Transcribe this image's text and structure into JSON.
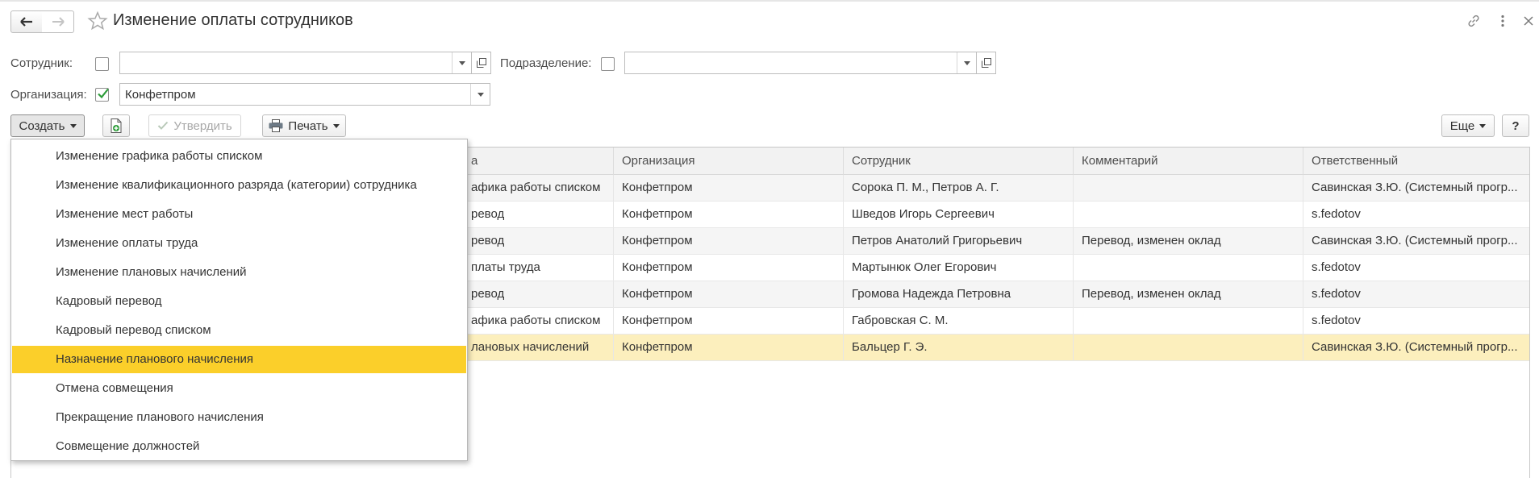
{
  "header": {
    "title": "Изменение оплаты сотрудников"
  },
  "filters": {
    "employee_label": "Сотрудник:",
    "employee_value": "",
    "department_label": "Подразделение:",
    "department_value": "",
    "organization_label": "Организация:",
    "organization_value": "Конфетпром",
    "organization_checked": true
  },
  "toolbar": {
    "create_label": "Создать",
    "approve_label": "Утвердить",
    "print_label": "Печать",
    "more_label": "Еще",
    "help_label": "?"
  },
  "table": {
    "columns": [
      "а",
      "Организация",
      "Сотрудник",
      "Комментарий",
      "Ответственный"
    ],
    "rows": [
      [
        "афика работы списком",
        "Конфетпром",
        "Сорока П. М., Петров А. Г.",
        "",
        "Савинская З.Ю. (Системный прогр..."
      ],
      [
        "ревод",
        "Конфетпром",
        "Шведов Игорь Сергеевич",
        "",
        "s.fedotov"
      ],
      [
        "ревод",
        "Конфетпром",
        "Петров Анатолий Григорьевич",
        "Перевод, изменен оклад",
        "Савинская З.Ю. (Системный прогр..."
      ],
      [
        "платы труда",
        "Конфетпром",
        "Мартынюк Олег Егорович",
        "",
        "s.fedotov"
      ],
      [
        "ревод",
        "Конфетпром",
        "Громова Надежда Петровна",
        "Перевод, изменен оклад",
        "s.fedotov"
      ],
      [
        "афика работы списком",
        "Конфетпром",
        "Габровская С. М.",
        "",
        "s.fedotov"
      ],
      [
        "лановых начислений",
        "Конфетпром",
        "Бальцер Г. Э.",
        "",
        "Савинская З.Ю. (Системный прогр..."
      ]
    ]
  },
  "create_menu": {
    "items": [
      "Изменение графика работы списком",
      "Изменение квалификационного разряда (категории) сотрудника",
      "Изменение мест работы",
      "Изменение оплаты труда",
      "Изменение плановых начислений",
      "Кадровый перевод",
      "Кадровый перевод списком",
      "Назначение планового начисления",
      "Отмена совмещения",
      "Прекращение планового начисления",
      "Совмещение должностей"
    ],
    "highlighted_item": "Назначение планового начисления"
  },
  "colors": {
    "menu_highlight": "#fbcf2a",
    "selected_row": "#fcefbd",
    "check_green": "#2e9d3a"
  }
}
